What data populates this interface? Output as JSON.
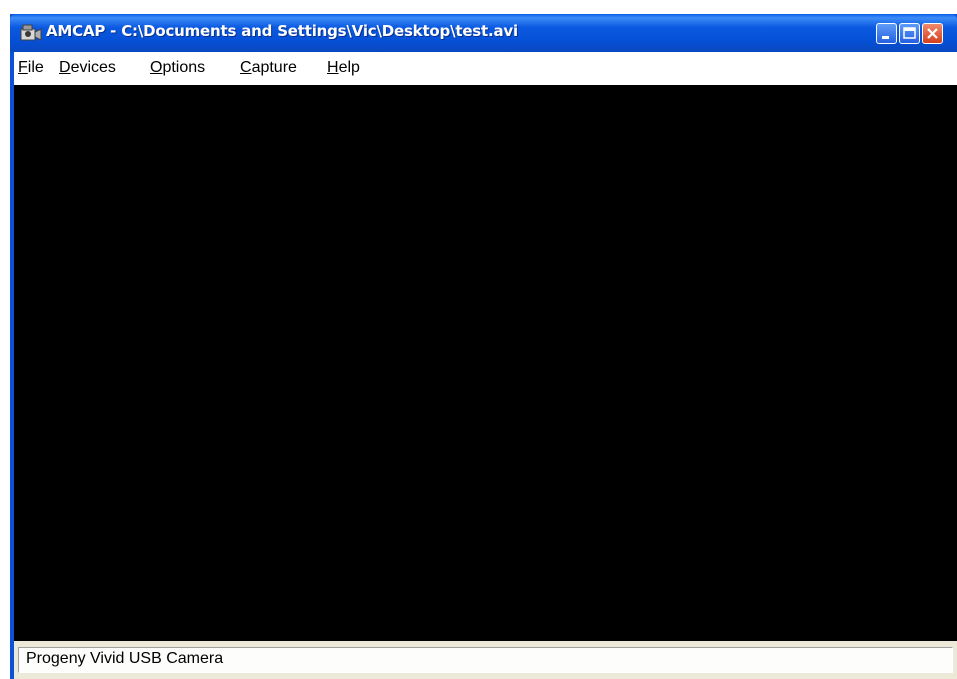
{
  "window": {
    "title": "AMCAP - C:\\Documents and Settings\\Vic\\Desktop\\test.avi"
  },
  "menu": {
    "items": [
      {
        "label": "File",
        "accel": "F",
        "rest": "ile"
      },
      {
        "label": "Devices",
        "accel": "D",
        "rest": "evices"
      },
      {
        "label": "Options",
        "accel": "O",
        "rest": "ptions"
      },
      {
        "label": "Capture",
        "accel": "C",
        "rest": "apture"
      },
      {
        "label": "Help",
        "accel": "H",
        "rest": "elp"
      }
    ]
  },
  "status": {
    "text": "Progeny Vivid USB Camera"
  },
  "icons": {
    "app": "camera-icon",
    "minimize": "minimize-icon",
    "maximize": "maximize-icon",
    "close": "close-icon"
  },
  "colors": {
    "titlebar": "#0550d6",
    "video_background": "#000000",
    "close_button": "#d4401d"
  }
}
